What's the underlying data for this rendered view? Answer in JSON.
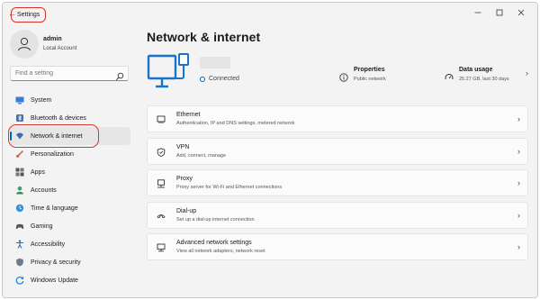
{
  "window": {
    "title": "Settings",
    "back_icon": "back-arrow-icon",
    "controls": [
      "minimize-icon",
      "maximize-icon",
      "close-icon"
    ]
  },
  "profile": {
    "name": "admin",
    "account_type": "Local Account",
    "avatar_icon": "user-icon"
  },
  "search": {
    "placeholder": "Find a setting",
    "value": "",
    "icon": "search-icon"
  },
  "sidebar": {
    "items": [
      {
        "label": "System",
        "icon": "system-icon",
        "active": false
      },
      {
        "label": "Bluetooth & devices",
        "icon": "bluetooth-icon",
        "active": false
      },
      {
        "label": "Network & internet",
        "icon": "wifi-icon",
        "active": true
      },
      {
        "label": "Personalization",
        "icon": "brush-icon",
        "active": false
      },
      {
        "label": "Apps",
        "icon": "apps-icon",
        "active": false
      },
      {
        "label": "Accounts",
        "icon": "accounts-icon",
        "active": false
      },
      {
        "label": "Time & language",
        "icon": "globe-clock-icon",
        "active": false
      },
      {
        "label": "Gaming",
        "icon": "gamepad-icon",
        "active": false
      },
      {
        "label": "Accessibility",
        "icon": "accessibility-icon",
        "active": false
      },
      {
        "label": "Privacy & security",
        "icon": "shield-icon",
        "active": false
      },
      {
        "label": "Windows Update",
        "icon": "update-icon",
        "active": false
      }
    ]
  },
  "main": {
    "title": "Network & internet",
    "connection": {
      "status": "Connected",
      "icon": "ethernet-monitor-icon"
    },
    "properties": {
      "title": "Properties",
      "subtitle": "Public network",
      "icon": "info-icon"
    },
    "data_usage": {
      "title": "Data usage",
      "subtitle": "25.27 GB, last 30 days",
      "icon": "data-usage-icon"
    },
    "cards": [
      {
        "title": "Ethernet",
        "desc": "Authentication, IP and DNS settings, metered network",
        "icon": "ethernet-icon"
      },
      {
        "title": "VPN",
        "desc": "Add, connect, manage",
        "icon": "vpn-shield-icon"
      },
      {
        "title": "Proxy",
        "desc": "Proxy server for Wi-Fi and Ethernet connections",
        "icon": "proxy-icon"
      },
      {
        "title": "Dial-up",
        "desc": "Set up a dial-up internet connection",
        "icon": "dialup-icon"
      },
      {
        "title": "Advanced network settings",
        "desc": "View all network adapters, network reset",
        "icon": "advanced-network-icon"
      }
    ]
  },
  "colors": {
    "accent": "#0067c0",
    "highlight": "#d9342b",
    "background": "#f3f3f3"
  }
}
